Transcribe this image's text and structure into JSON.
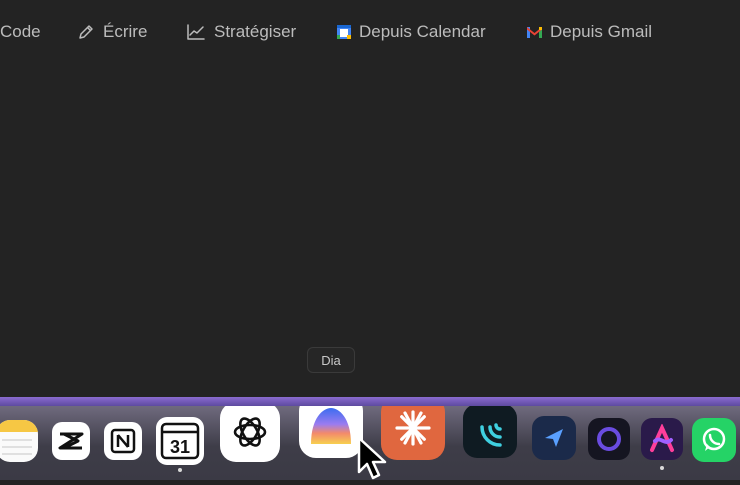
{
  "toolbar": {
    "code_label": "Code",
    "ecrire_label": "Écrire",
    "strategiser_label": "Stratégiser",
    "calendar_label": "Depuis Calendar",
    "gmail_label": "Depuis Gmail"
  },
  "tooltip": {
    "label": "Dia"
  },
  "calendar_icon": {
    "day": "31"
  },
  "colors": {
    "background": "#232323",
    "toolbar_text": "#bcbcbc",
    "dock_accent": "#8a6bd0"
  },
  "dock": {
    "apps": [
      {
        "name": "notes-app-icon"
      },
      {
        "name": "capcut-app-icon"
      },
      {
        "name": "notion-app-icon"
      },
      {
        "name": "calendar-app-icon"
      },
      {
        "name": "chatgpt-app-icon"
      },
      {
        "name": "dia-app-icon"
      },
      {
        "name": "claude-app-icon"
      },
      {
        "name": "wave-app-icon"
      },
      {
        "name": "send-app-icon"
      },
      {
        "name": "ring-app-icon"
      },
      {
        "name": "arc-app-icon"
      },
      {
        "name": "whatsapp-app-icon"
      }
    ]
  }
}
